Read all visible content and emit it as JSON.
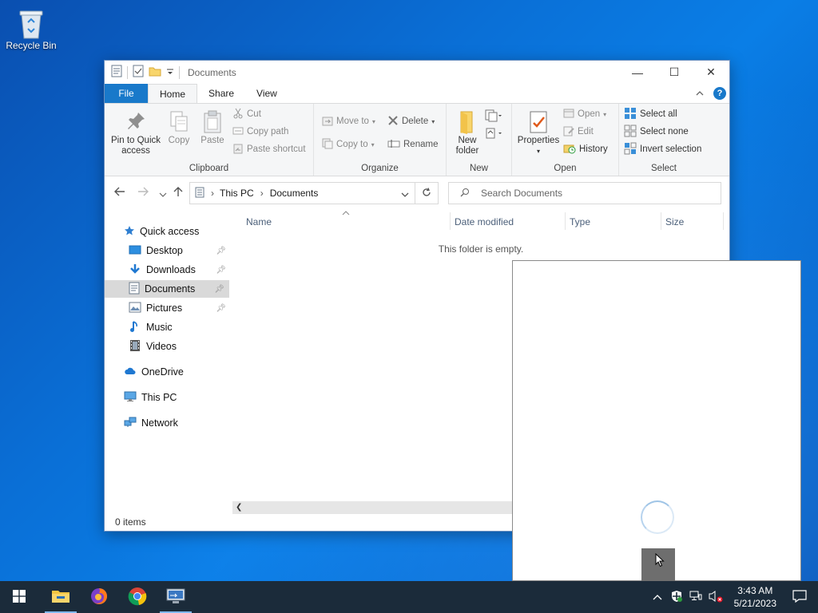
{
  "desktop": {
    "recycle_bin_label": "Recycle Bin"
  },
  "window": {
    "title": "Documents",
    "controls": {
      "minimize": "—",
      "maximize": "☐",
      "close": "✕"
    },
    "tabs": [
      {
        "label": "File"
      },
      {
        "label": "Home"
      },
      {
        "label": "Share"
      },
      {
        "label": "View"
      }
    ],
    "ribbon": {
      "clipboard": {
        "group_label": "Clipboard",
        "pin_label_1": "Pin to Quick",
        "pin_label_2": "access",
        "copy": "Copy",
        "paste": "Paste",
        "cut": "Cut",
        "copy_path": "Copy path",
        "paste_shortcut": "Paste shortcut"
      },
      "organize": {
        "group_label": "Organize",
        "move_to": "Move to",
        "copy_to": "Copy to",
        "delete": "Delete",
        "rename": "Rename"
      },
      "new": {
        "group_label": "New",
        "new_folder_1": "New",
        "new_folder_2": "folder"
      },
      "open": {
        "group_label": "Open",
        "properties": "Properties",
        "open": "Open",
        "edit": "Edit",
        "history": "History"
      },
      "select": {
        "group_label": "Select",
        "select_all": "Select all",
        "select_none": "Select none",
        "invert": "Invert selection"
      }
    },
    "address": {
      "crumbs": [
        "This PC",
        "Documents"
      ],
      "search_placeholder": "Search Documents"
    },
    "nav_pane": {
      "quick_access": "Quick access",
      "items": [
        {
          "label": "Desktop",
          "pinned": true
        },
        {
          "label": "Downloads",
          "pinned": true
        },
        {
          "label": "Documents",
          "pinned": true
        },
        {
          "label": "Pictures",
          "pinned": true
        },
        {
          "label": "Music",
          "pinned": false
        },
        {
          "label": "Videos",
          "pinned": false
        }
      ],
      "onedrive": "OneDrive",
      "this_pc": "This PC",
      "network": "Network"
    },
    "columns": [
      "Name",
      "Date modified",
      "Type",
      "Size"
    ],
    "empty_message": "This folder is empty.",
    "status": "0 items"
  },
  "taskbar": {
    "time": "3:43 AM",
    "date": "5/21/2023"
  },
  "colors": {
    "accent": "#1979ca",
    "taskbar": "#1b2b3a",
    "desktop": "#0a6fd6"
  }
}
